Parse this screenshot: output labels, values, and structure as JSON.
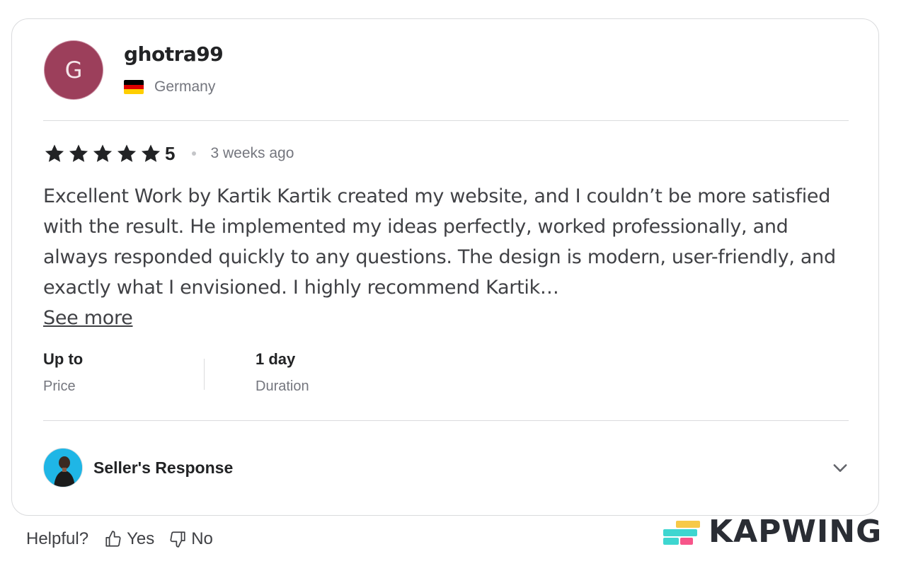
{
  "reviewer": {
    "initial": "G",
    "username": "ghotra99",
    "country": "Germany"
  },
  "rating": {
    "stars": 5,
    "value": "5",
    "time_ago": "3 weeks ago"
  },
  "review": {
    "text": "Excellent Work by Kartik Kartik created my website, and I couldn’t be more satisfied with the result. He implemented my ideas perfectly, worked professionally, and always responded quickly to any questions. The design is modern, user-friendly, and exactly what I envisioned. I highly recommend Kartik…",
    "see_more": "See more"
  },
  "meta": {
    "price_value": "Up to",
    "price_label": "Price",
    "duration_value": "1 day",
    "duration_label": "Duration"
  },
  "seller_response": {
    "title": "Seller's Response"
  },
  "helpful": {
    "label": "Helpful?",
    "yes": "Yes",
    "no": "No"
  },
  "watermark": {
    "text": "KAPWING"
  },
  "colors": {
    "avatar_bg": "#9c3f5b",
    "star": "#222325",
    "border": "#dadbdd",
    "muted_text": "#74767e"
  }
}
